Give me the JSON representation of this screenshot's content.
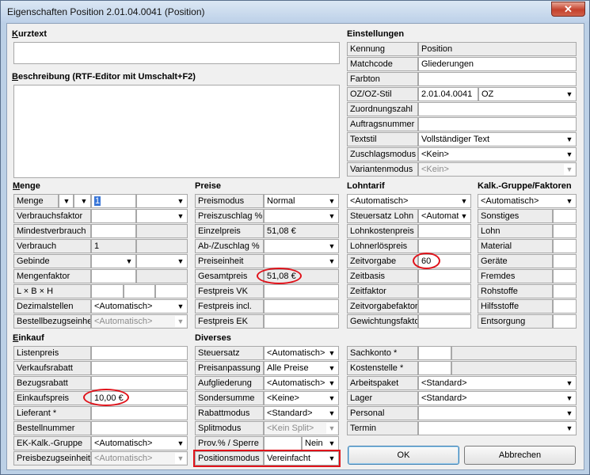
{
  "window": {
    "title": "Eigenschaften Position 2.01.04.0041 (Position)",
    "close": "✕"
  },
  "kurztext": {
    "heading": "Kurztext",
    "value": ""
  },
  "beschreibung": {
    "heading": "Beschreibung (RTF-Editor mit Umschalt+F2)",
    "value": ""
  },
  "einstellungen": {
    "heading": "Einstellungen",
    "kennung_label": "Kennung",
    "kennung_value": "Position",
    "matchcode_label": "Matchcode",
    "matchcode_value": "Gliederungen",
    "farbton_label": "Farbton",
    "farbton_value": "",
    "ozstil_label": "OZ/OZ-Stil",
    "ozstil_value": "2.01.04.0041",
    "ozstil_select": "OZ",
    "zuordnungszahl_label": "Zuordnungszahl",
    "auftragsnummer_label": "Auftragsnummer",
    "textstil_label": "Textstil",
    "textstil_value": "Vollständiger Text",
    "zuschlagsmodus_label": "Zuschlagsmodus",
    "zuschlagsmodus_value": "<Kein>",
    "variantenmodus_label": "Variantenmodus",
    "variantenmodus_value": "<Kein>"
  },
  "menge": {
    "heading": "Menge",
    "menge_label": "Menge",
    "menge_value": "1",
    "verbrauchsfaktor_label": "Verbrauchsfaktor",
    "mindestverbrauch_label": "Mindestverbrauch",
    "verbrauch_label": "Verbrauch",
    "verbrauch_value": "1",
    "gebinde_label": "Gebinde",
    "mengenfaktor_label": "Mengenfaktor",
    "lbh_label": "L × B × H",
    "dezimalstellen_label": "Dezimalstellen",
    "dezimalstellen_value": "<Automatisch>",
    "bestellbezug_label": "Bestellbezugseinheit",
    "bestellbezug_value": "<Automatisch>"
  },
  "preise": {
    "heading": "Preise",
    "preismodus_label": "Preismodus",
    "preismodus_value": "Normal",
    "preiszuschlag_label": "Preiszuschlag %",
    "einzelpreis_label": "Einzelpreis",
    "einzelpreis_value": "51,08 €",
    "abzuschlag_label": "Ab-/Zuschlag %",
    "preiseinheit_label": "Preiseinheit",
    "gesamtpreis_label": "Gesamtpreis",
    "gesamtpreis_value": "51,08 €",
    "festpreis_vk_label": "Festpreis VK",
    "festpreis_incl_label": "Festpreis incl.",
    "festpreis_ek_label": "Festpreis EK"
  },
  "lohntarif": {
    "heading": "Lohntarif",
    "tarif_value": "<Automatisch>",
    "steuersatz_label": "Steuersatz Lohn",
    "steuersatz_value": "<Automat",
    "lohnkostenpreis_label": "Lohnkostenpreis",
    "lohnerloespreis_label": "Lohnerlöspreis",
    "zeitvorgabe_label": "Zeitvorgabe",
    "zeitvorgabe_value": "60",
    "zeitbasis_label": "Zeitbasis",
    "zeitfaktor_label": "Zeitfaktor",
    "zeitvorgabefaktor_label": "Zeitvorgabefaktor",
    "gewichtungsfaktor_label": "Gewichtungsfaktor"
  },
  "kalk": {
    "heading": "Kalk.-Gruppe/Faktoren",
    "gruppe_value": "<Automatisch>",
    "rows": [
      "Sonstiges",
      "Lohn",
      "Material",
      "Geräte",
      "Fremdes",
      "Rohstoffe",
      "Hilfsstoffe",
      "Entsorgung"
    ]
  },
  "einkauf": {
    "heading": "Einkauf",
    "listenpreis_label": "Listenpreis",
    "verkaufsrabatt_label": "Verkaufsrabatt",
    "bezugsrabatt_label": "Bezugsrabatt",
    "einkaufspreis_label": "Einkaufspreis",
    "einkaufspreis_value": "10,00 €",
    "lieferant_label": "Lieferant *",
    "bestellnummer_label": "Bestellnummer",
    "ekkalk_label": "EK-Kalk.-Gruppe",
    "ekkalk_value": "<Automatisch>",
    "preisbezug_label": "Preisbezugseinheit",
    "preisbezug_value": "<Automatisch>"
  },
  "diverses": {
    "heading": "Diverses",
    "steuersatz_label": "Steuersatz",
    "steuersatz_value": "<Automatisch>",
    "preisanpassung_label": "Preisanpassung",
    "preisanpassung_value": "Alle Preise",
    "aufgliederung_label": "Aufgliederung",
    "aufgliederung_value": "<Automatisch>",
    "sondersumme_label": "Sondersumme",
    "sondersumme_value": "<Keine>",
    "rabattmodus_label": "Rabattmodus",
    "rabattmodus_value": "<Standard>",
    "splitmodus_label": "Splitmodus",
    "splitmodus_value": "<Kein Split>",
    "prov_label": "Prov.% / Sperre",
    "prov_value": "Nein",
    "positionsmodus_label": "Positionsmodus",
    "positionsmodus_value": "Vereinfacht"
  },
  "konto": {
    "sachkonto_label": "Sachkonto *",
    "kostenstelle_label": "Kostenstelle *",
    "arbeitspaket_label": "Arbeitspaket",
    "arbeitspaket_value": "<Standard>",
    "lager_label": "Lager",
    "lager_value": "<Standard>",
    "personal_label": "Personal",
    "termin_label": "Termin"
  },
  "buttons": {
    "ok": "OK",
    "cancel": "Abbrechen"
  },
  "glyphs": {
    "dropdown": "▼"
  },
  "colors": {
    "highlight": "#e0121a",
    "selection": "#3875d7"
  }
}
